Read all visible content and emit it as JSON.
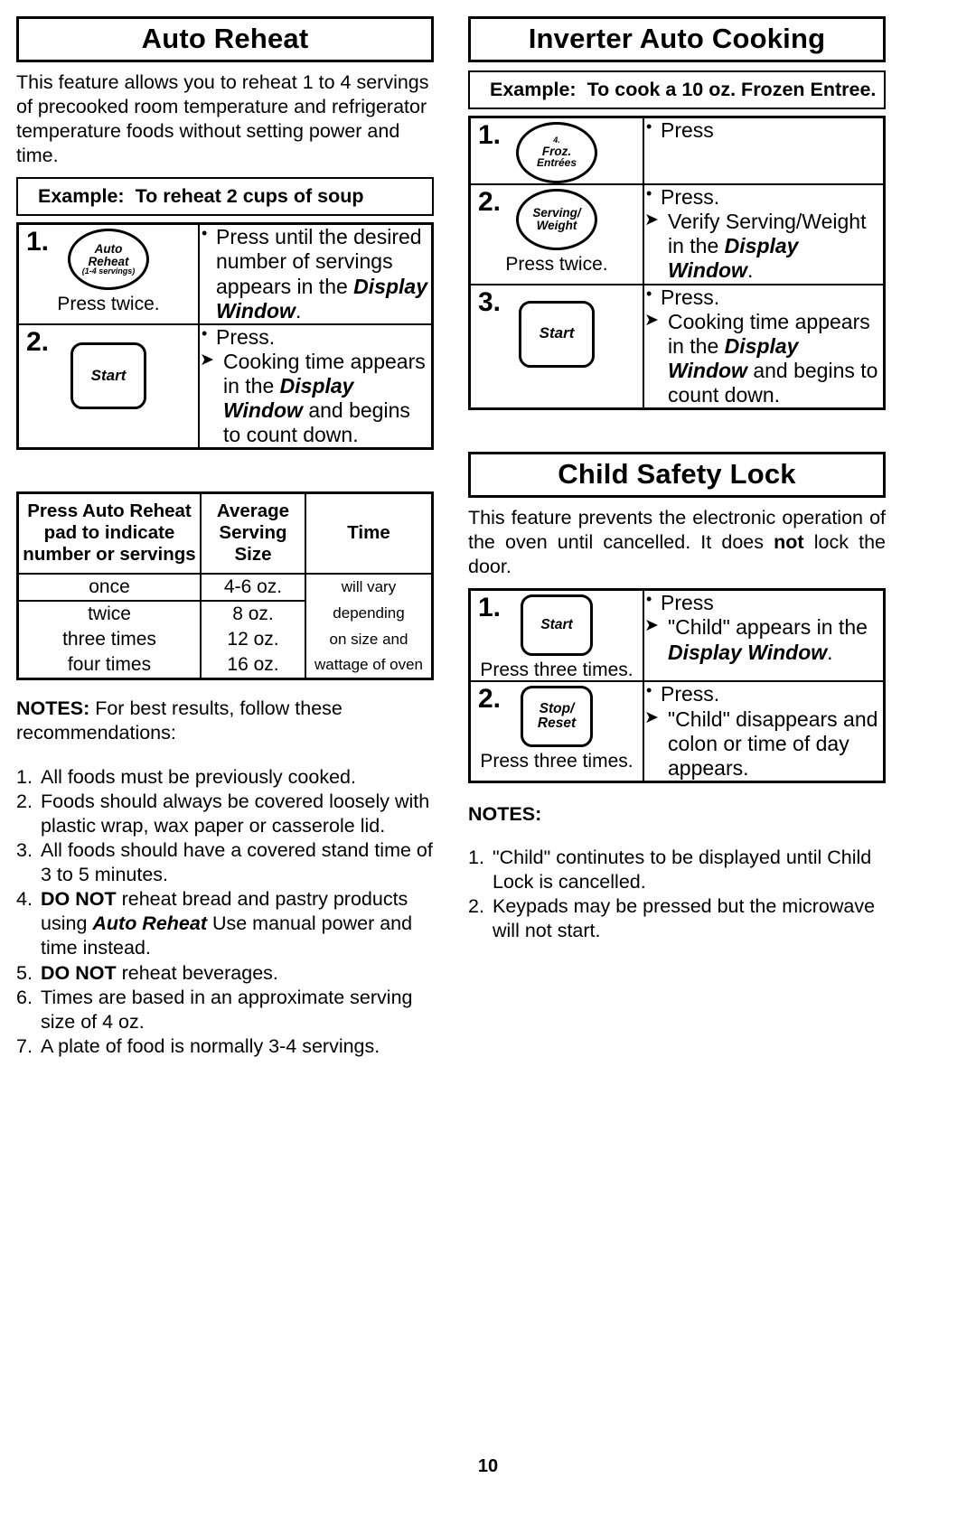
{
  "page": {
    "number": "10"
  },
  "auto_reheat": {
    "title": "Auto Reheat",
    "intro": "This feature allows you to reheat 1 to 4 servings of precooked room temperature and refrigerator temperature foods without setting power and time.",
    "example_label": "Example:",
    "example_text": "To reheat 2 cups of soup",
    "steps": [
      {
        "num": "1.",
        "pad_type": "oval",
        "pad_line1": "Auto",
        "pad_line2": "Reheat",
        "pad_line3": "(1-4 servings)",
        "press_note": "Press twice.",
        "desc_bullet": "Press until the desired number of servings appears in the",
        "desc_emph": "Display Window",
        "desc_tail": "."
      },
      {
        "num": "2.",
        "pad_type": "square",
        "pad_label": "Start",
        "press_note": "",
        "desc_bullet": "Press.",
        "desc_arrow_pre": "Cooking time appears in the",
        "desc_arrow_emph": "Display Window",
        "desc_arrow_post": "and begins to count down."
      }
    ],
    "servings_table": {
      "headers": [
        "Press Auto Reheat pad to indicate number or servings",
        "Average Serving Size",
        "Time"
      ],
      "rows": [
        [
          "once",
          "4-6 oz.",
          "will vary"
        ],
        [
          "twice",
          "8 oz.",
          "depending"
        ],
        [
          "three times",
          "12 oz.",
          "on size and"
        ],
        [
          "four times",
          "16 oz.",
          "wattage of oven"
        ]
      ]
    },
    "notes_label": "NOTES:",
    "notes_intro": "For best results, follow these recommendations:",
    "notes": [
      {
        "num": "1.",
        "text": "All foods must be previously cooked."
      },
      {
        "num": "2.",
        "text": "Foods should always be covered loosely with plastic wrap, wax paper or casserole lid."
      },
      {
        "num": "3.",
        "text": "All foods should have a covered stand time of 3 to 5 minutes."
      },
      {
        "num": "4.",
        "bold": "DO NOT",
        "text": " reheat bread and pastry products using ",
        "italic": "Auto Reheat",
        "text2": " Use manual power and time instead."
      },
      {
        "num": "5.",
        "bold": "DO NOT",
        "text": " reheat beverages."
      },
      {
        "num": "6.",
        "text": "Times are based in an approximate serving size of 4 oz."
      },
      {
        "num": "7.",
        "text": "A plate of food is normally 3-4 servings."
      }
    ]
  },
  "inverter_auto_cooking": {
    "title": "Inverter Auto Cooking",
    "example_label": "Example:",
    "example_text": "To cook a 10 oz. Frozen Entree.",
    "steps": [
      {
        "num": "1.",
        "pad_type": "oval",
        "pad_line1": "4.",
        "pad_line2": "Froz.",
        "pad_line3": "Entrées",
        "press_note": "",
        "desc_bullet": "Press"
      },
      {
        "num": "2.",
        "pad_type": "oval",
        "pad_line1": "Serving/",
        "pad_line2": "Weight",
        "pad_line3": "",
        "press_note": "Press twice.",
        "desc_bullet": "Press.",
        "desc_arrow_pre": "Verify Serving/Weight in the",
        "desc_arrow_emph": "Display Window",
        "desc_arrow_post": "."
      },
      {
        "num": "3.",
        "pad_type": "square",
        "pad_label": "Start",
        "press_note": "",
        "desc_bullet": "Press.",
        "desc_arrow_pre": "Cooking time appears in the",
        "desc_arrow_emph": "Display Window",
        "desc_arrow_post": "and begins to count down."
      }
    ]
  },
  "child_safety_lock": {
    "title": "Child Safety Lock",
    "intro_a": "This feature prevents the electronic operation of the oven until cancelled. It does ",
    "intro_bold": "not",
    "intro_b": " lock the door.",
    "steps": [
      {
        "num": "1.",
        "pad_type": "square",
        "pad_label": "Start",
        "press_note": "Press three times.",
        "desc_bullet": "Press",
        "desc_arrow_pre": "\"Child\" appears in the",
        "desc_arrow_emph": "Display Window",
        "desc_arrow_post": "."
      },
      {
        "num": "2.",
        "pad_type": "square",
        "pad_label_line1": "Stop/",
        "pad_label_line2": "Reset",
        "press_note": "Press three times.",
        "desc_bullet": "Press.",
        "desc_arrow_pre": "\"Child\" disappears and colon or time of day appears.",
        "desc_arrow_emph": "",
        "desc_arrow_post": ""
      }
    ],
    "notes_label": "NOTES:",
    "notes": [
      {
        "num": "1.",
        "text": "\"Child\" continutes to be displayed until Child Lock is cancelled."
      },
      {
        "num": "2.",
        "text": "Keypads may be pressed but the microwave will not start."
      }
    ]
  }
}
